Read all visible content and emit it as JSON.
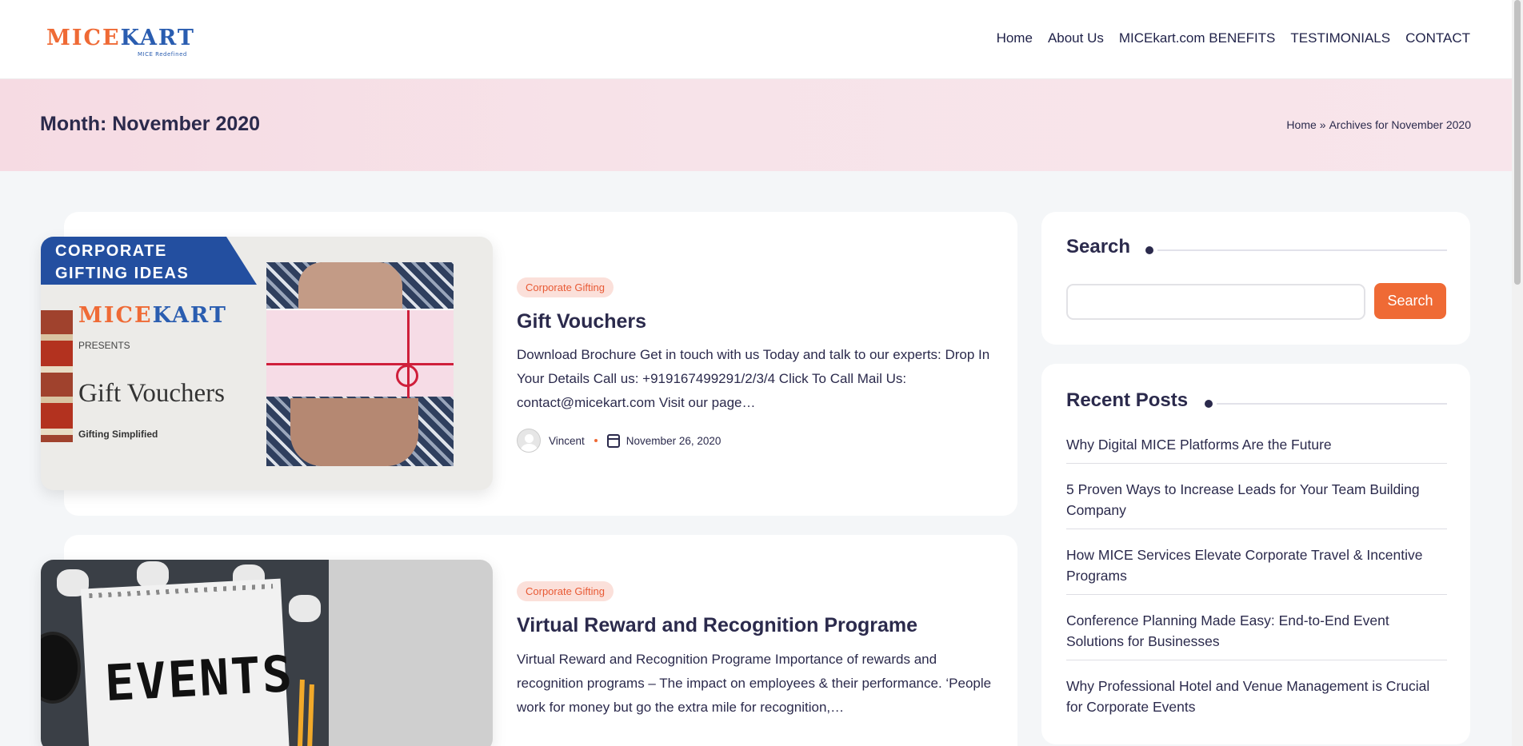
{
  "header": {
    "logo": {
      "text_a": "MICE",
      "text_b": "KART",
      "tagline": "MICE Redefined"
    },
    "nav": [
      "Home",
      "About Us",
      "MICEkart.com BENEFITS",
      "TESTIMONIALS",
      "CONTACT"
    ]
  },
  "banner": {
    "title": "Month: November 2020",
    "breadcrumb": {
      "home": "Home",
      "separator": "»",
      "current": "Archives for November 2020"
    }
  },
  "posts": [
    {
      "category": "Corporate Gifting",
      "title": "Gift Vouchers",
      "excerpt": "Download Brochure Get in touch with us Today and talk to our experts: Drop In Your Details   Call us: +919167499291/2/3/4 Click To Call Mail Us: contact@micekart.com Visit our page…",
      "author": "Vincent",
      "date": "November 26, 2020",
      "thumb": {
        "ribbon": "CORPORATE\nGIFTING IDEAS",
        "logo_a": "MICE",
        "logo_b": "KART",
        "presents": "PRESENTS",
        "headline": "Gift Vouchers",
        "sub": "Gifting Simplified"
      }
    },
    {
      "category": "Corporate Gifting",
      "title": "Virtual Reward and Recognition Programe",
      "excerpt": "Virtual Reward and Recognition Programe Importance of rewards and recognition programs – The impact on employees & their performance. ‘People work for money but go the extra mile for recognition,…",
      "thumb": {
        "word": "EVENTS"
      }
    }
  ],
  "sidebar": {
    "search": {
      "title": "Search",
      "button": "Search",
      "value": ""
    },
    "recent": {
      "title": "Recent Posts",
      "items": [
        "Why Digital MICE Platforms Are the Future",
        "5 Proven Ways to Increase Leads for Your Team Building Company",
        "How MICE Services Elevate Corporate Travel & Incentive Programs",
        "Conference Planning Made Easy: End-to-End Event Solutions for Businesses",
        "Why Professional Hotel and Venue Management is Crucial for Corporate Events"
      ]
    }
  },
  "colors": {
    "accent": "#ef6a35",
    "navy": "#2b2a4c",
    "brand_blue": "#2a5db0",
    "banner": "#f7e1e8"
  }
}
